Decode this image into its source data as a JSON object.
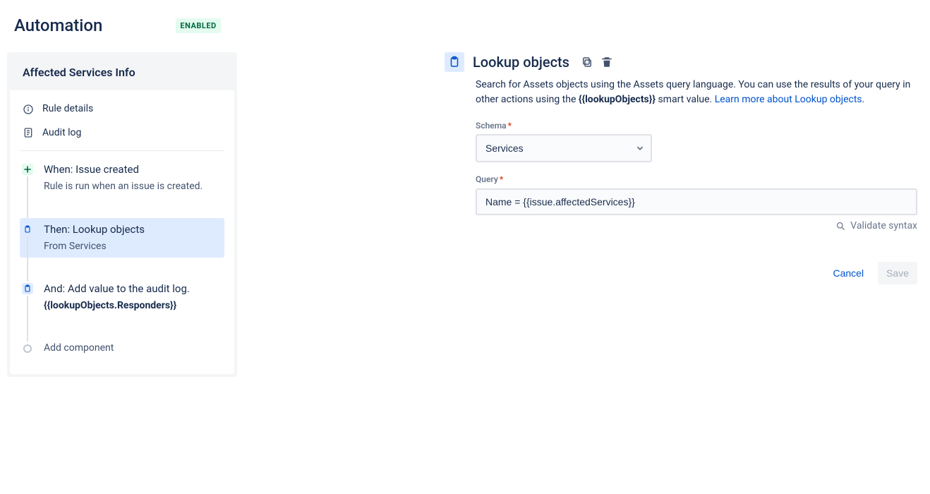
{
  "header": {
    "title": "Automation",
    "status_badge": "ENABLED"
  },
  "rule_card": {
    "name": "Affected Services Info",
    "meta": {
      "rule_details": "Rule details",
      "audit_log": "Audit log"
    },
    "steps": {
      "trigger": {
        "title": "When: Issue created",
        "subtitle": "Rule is run when an issue is created."
      },
      "action1": {
        "title": "Then: Lookup objects",
        "subtitle": "From Services"
      },
      "action2": {
        "title": "And: Add value to the audit log.",
        "subtitle_smart": "{{lookupObjects.Responders}}"
      },
      "add_component": "Add component"
    }
  },
  "detail": {
    "title": "Lookup objects",
    "description_pre": "Search for Assets objects using the Assets query language. You can use the results of your query in other actions using the ",
    "description_smart": "{{lookupObjects}}",
    "description_post": " smart value. ",
    "learn_more": "Learn more about Lookup objects",
    "period": ".",
    "schema": {
      "label": "Schema",
      "value": "Services"
    },
    "query": {
      "label": "Query",
      "value": "Name = {{issue.affectedServices}}"
    },
    "validate": "Validate syntax",
    "buttons": {
      "cancel": "Cancel",
      "save": "Save"
    }
  }
}
